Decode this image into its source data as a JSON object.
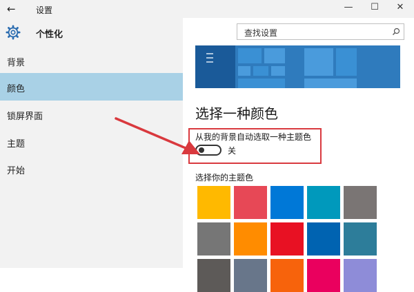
{
  "window": {
    "title": "设置",
    "back_icon": "←",
    "minimize": "—",
    "maximize": "☐",
    "close": "✕"
  },
  "sidebar": {
    "title": "个性化",
    "items": [
      {
        "label": "背景",
        "active": false
      },
      {
        "label": "颜色",
        "active": true
      },
      {
        "label": "锁屏界面",
        "active": false
      },
      {
        "label": "主题",
        "active": false
      },
      {
        "label": "开始",
        "active": false
      }
    ]
  },
  "search": {
    "placeholder": "查找设置"
  },
  "main": {
    "heading": "选择一种颜色",
    "auto_pick_label": "从我的背景自动选取一种主题色",
    "toggle_state": "关",
    "accent_label": "选择你的主题色"
  },
  "colors": {
    "sidebar_bg": "#f2f2f2",
    "active_item": "#a9d1e6",
    "preview_bg": "#3b86c6",
    "annotation_red": "#d9393e",
    "swatches": [
      "#ffb900",
      "#e74856",
      "#0078d7",
      "#0099bc",
      "#7a7574",
      "#767676",
      "#ff8c00",
      "#e81123",
      "#0063b1",
      "#2d7d9a",
      "#5d5a58",
      "#68768a",
      "#f7630c",
      "#ea005e",
      "#8e8cd8"
    ]
  }
}
